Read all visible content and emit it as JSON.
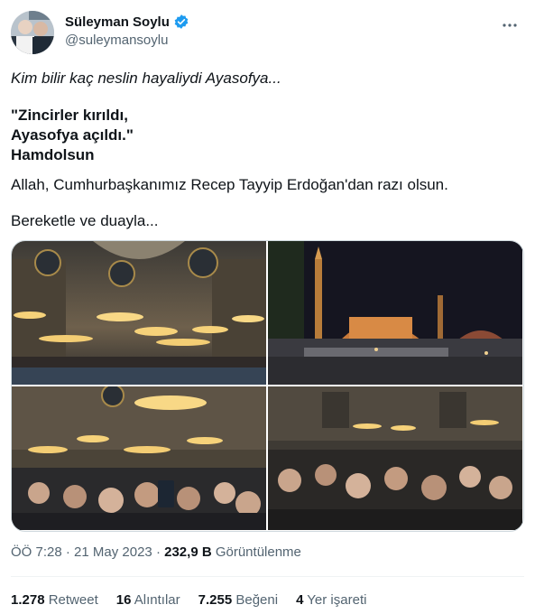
{
  "author": {
    "name": "Süleyman Soylu",
    "handle": "@suleymansoylu",
    "avatar_icon": "user-avatar",
    "verified_icon": "verified-badge-icon",
    "verified_color": "#1d9bf0"
  },
  "tweet": {
    "line1": "Kim bilir kaç neslin hayaliydi Ayasofya...",
    "quote_line1": "\"Zincirler kırıldı,",
    "quote_line2": "Ayasofya açıldı.\"",
    "quote_line3": "Hamdolsun",
    "line3": "Allah, Cumhurbaşkanımız Recep Tayyip Erdoğan'dan razı olsun.",
    "line4": "Bereketle ve duayla..."
  },
  "media": {
    "photos": [
      "interior-chandeliers",
      "exterior-night",
      "crowd-interior",
      "crowd-selfie"
    ]
  },
  "meta": {
    "time": "ÖÖ 7:28",
    "separator1": " · ",
    "date": "21 May 2023",
    "separator2": " · ",
    "views_count": "232,9 B",
    "views_label": " Görüntülenme"
  },
  "stats": {
    "retweets_count": "1.278",
    "retweets_label": " Retweet",
    "quotes_count": "16",
    "quotes_label": " Alıntılar",
    "likes_count": "7.255",
    "likes_label": " Beğeni",
    "bookmarks_count": "4",
    "bookmarks_label": " Yer işareti"
  },
  "colors": {
    "text_primary": "#0f1419",
    "text_secondary": "#536471",
    "border": "#cfd9de"
  }
}
